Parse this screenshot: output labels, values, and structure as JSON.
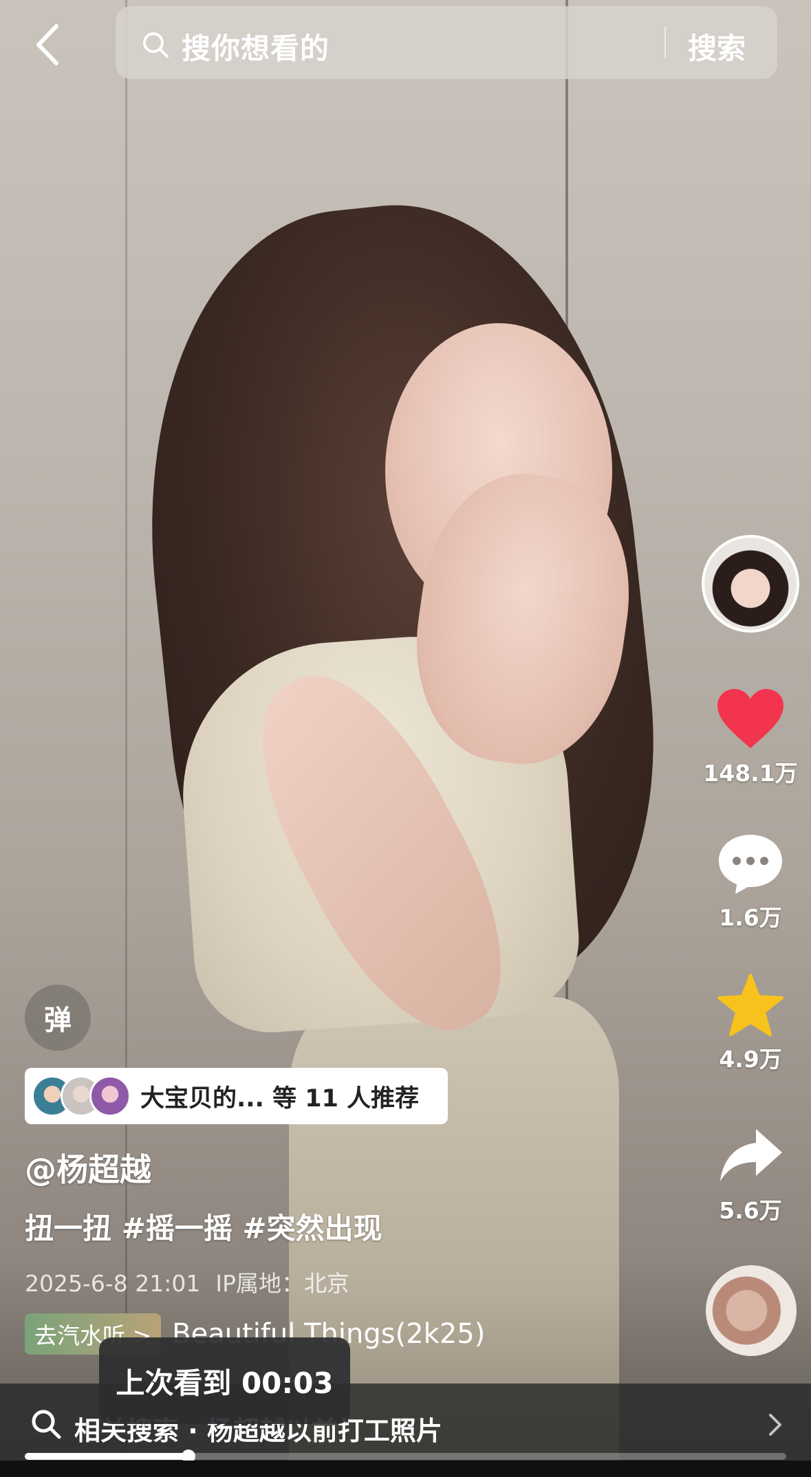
{
  "search": {
    "placeholder": "搜你想看的",
    "button_label": "搜索"
  },
  "actions": {
    "likes": "148.1万",
    "comments": "1.6万",
    "favorites": "4.9万",
    "shares": "5.6万"
  },
  "danmaku_label": "弹",
  "recommend": {
    "text": "大宝贝的... 等 11 人推荐"
  },
  "post": {
    "author": "@杨超越",
    "description": "扭一扭 #摇一摇 #突然出现",
    "date": "2025-6-8 21:01",
    "ip_location": "IP属地：北京"
  },
  "music": {
    "tag_label": "去汽水听 >",
    "title": "Beautiful Things(2k25)"
  },
  "toast": {
    "text": "上次看到 00:03"
  },
  "related_search": {
    "text": "相关搜索 · 杨超越以前打工照片"
  },
  "progress": {
    "fraction": 0.215
  },
  "colors": {
    "like": "#f2344f",
    "favorite": "#f8c21c"
  }
}
